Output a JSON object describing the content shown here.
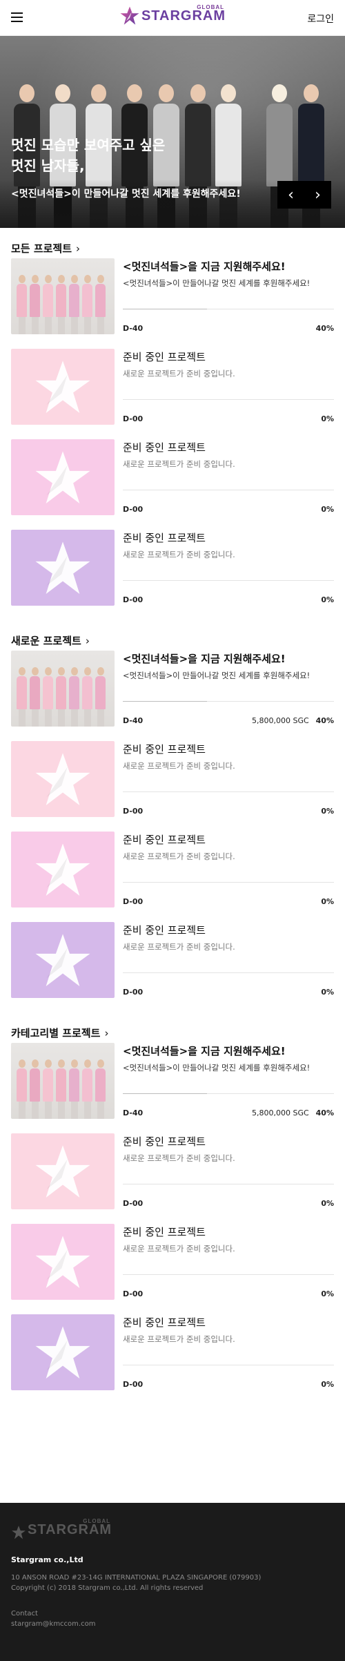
{
  "header": {
    "logo_global": "GLOBAL",
    "logo_name": "STARGRAM",
    "login_label": "로그인"
  },
  "hero": {
    "title_line1": "멋진 모습만 보여주고 싶은",
    "title_line2": "멋진 남자들,",
    "subtitle": "<멋진녀석들>이 만들어나갈 멋진 세계를 후원해주세요!",
    "prev_label": "‹",
    "next_label": "›"
  },
  "sections": [
    {
      "title": "모든 프로젝트",
      "chevron": "›",
      "cards": [
        {
          "thumb": "photo",
          "title": "<멋진녀석들>을 지금 지원해주세요!",
          "desc": "<멋진녀석들>이 만들어나갈 멋진 세계를 후원해주세요!",
          "dday": "D-40",
          "amount": "",
          "percent_label": "40%",
          "progress": 0.4,
          "active": true
        },
        {
          "thumb": "pink",
          "title": "준비 중인 프로젝트",
          "desc": "새로운 프로젝트가 준비 중입니다.",
          "dday": "D-00",
          "amount": "",
          "percent_label": "0%",
          "progress": 0,
          "active": false
        },
        {
          "thumb": "pink2",
          "title": "준비 중인 프로젝트",
          "desc": "새로운 프로젝트가 준비 중입니다.",
          "dday": "D-00",
          "amount": "",
          "percent_label": "0%",
          "progress": 0,
          "active": false
        },
        {
          "thumb": "purple",
          "title": "준비 중인 프로젝트",
          "desc": "새로운 프로젝트가 준비 중입니다.",
          "dday": "D-00",
          "amount": "",
          "percent_label": "0%",
          "progress": 0,
          "active": false
        }
      ]
    },
    {
      "title": "새로운 프로젝트",
      "chevron": "›",
      "cards": [
        {
          "thumb": "photo",
          "title": "<멋진녀석들>을 지금 지원해주세요!",
          "desc": "<멋진녀석들>이 만들어나갈 멋진 세계를 후원해주세요!",
          "dday": "D-40",
          "amount": "5,800,000 SGC",
          "percent_label": "40%",
          "progress": 0.4,
          "active": true
        },
        {
          "thumb": "pink",
          "title": "준비 중인 프로젝트",
          "desc": "새로운 프로젝트가 준비 중입니다.",
          "dday": "D-00",
          "amount": "",
          "percent_label": "0%",
          "progress": 0,
          "active": false
        },
        {
          "thumb": "pink2",
          "title": "준비 중인 프로젝트",
          "desc": "새로운 프로젝트가 준비 중입니다.",
          "dday": "D-00",
          "amount": "",
          "percent_label": "0%",
          "progress": 0,
          "active": false
        },
        {
          "thumb": "purple",
          "title": "준비 중인 프로젝트",
          "desc": "새로운 프로젝트가 준비 중입니다.",
          "dday": "D-00",
          "amount": "",
          "percent_label": "0%",
          "progress": 0,
          "active": false
        }
      ]
    },
    {
      "title": "카테고리별 프로젝트",
      "chevron": "›",
      "cards": [
        {
          "thumb": "photo",
          "title": "<멋진녀석들>을 지금 지원해주세요!",
          "desc": "<멋진녀석들>이 만들어나갈 멋진 세계를 후원해주세요!",
          "dday": "D-40",
          "amount": "5,800,000 SGC",
          "percent_label": "40%",
          "progress": 0.4,
          "active": true
        },
        {
          "thumb": "pink",
          "title": "준비 중인 프로젝트",
          "desc": "새로운 프로젝트가 준비 중입니다.",
          "dday": "D-00",
          "amount": "",
          "percent_label": "0%",
          "progress": 0,
          "active": false
        },
        {
          "thumb": "pink2",
          "title": "준비 중인 프로젝트",
          "desc": "새로운 프로젝트가 준비 중입니다.",
          "dday": "D-00",
          "amount": "",
          "percent_label": "0%",
          "progress": 0,
          "active": false
        },
        {
          "thumb": "purple",
          "title": "준비 중인 프로젝트",
          "desc": "새로운 프로젝트가 준비 중입니다.",
          "dday": "D-00",
          "amount": "",
          "percent_label": "0%",
          "progress": 0,
          "active": false
        }
      ]
    }
  ],
  "footer": {
    "logo_global": "GLOBAL",
    "logo_name": "STARGRAM",
    "company": "Stargram co.,Ltd",
    "address": "10 ANSON ROAD #23-14G INTERNATIONAL PLAZA SINGAPORE (079903)",
    "copyright": "Copyright (c) 2018 Stargram co.,Ltd. All rights reserved",
    "contact_label": "Contact",
    "email": "stargram@kmccom.com"
  },
  "colors": {
    "brand_purple": "#6b3fa0",
    "thumb_pink": "#fcd7e2",
    "thumb_pink2": "#f9cbe8",
    "thumb_purple": "#d5b9ea",
    "footer_bg": "#1b1b1b"
  },
  "icons": {
    "menu": "hamburger-icon",
    "logo": "star-logo-icon",
    "placeholder": "star-placeholder-icon",
    "section_more": "chevron-right-icon",
    "hero_prev": "chevron-left-icon",
    "hero_next": "chevron-right-icon"
  }
}
